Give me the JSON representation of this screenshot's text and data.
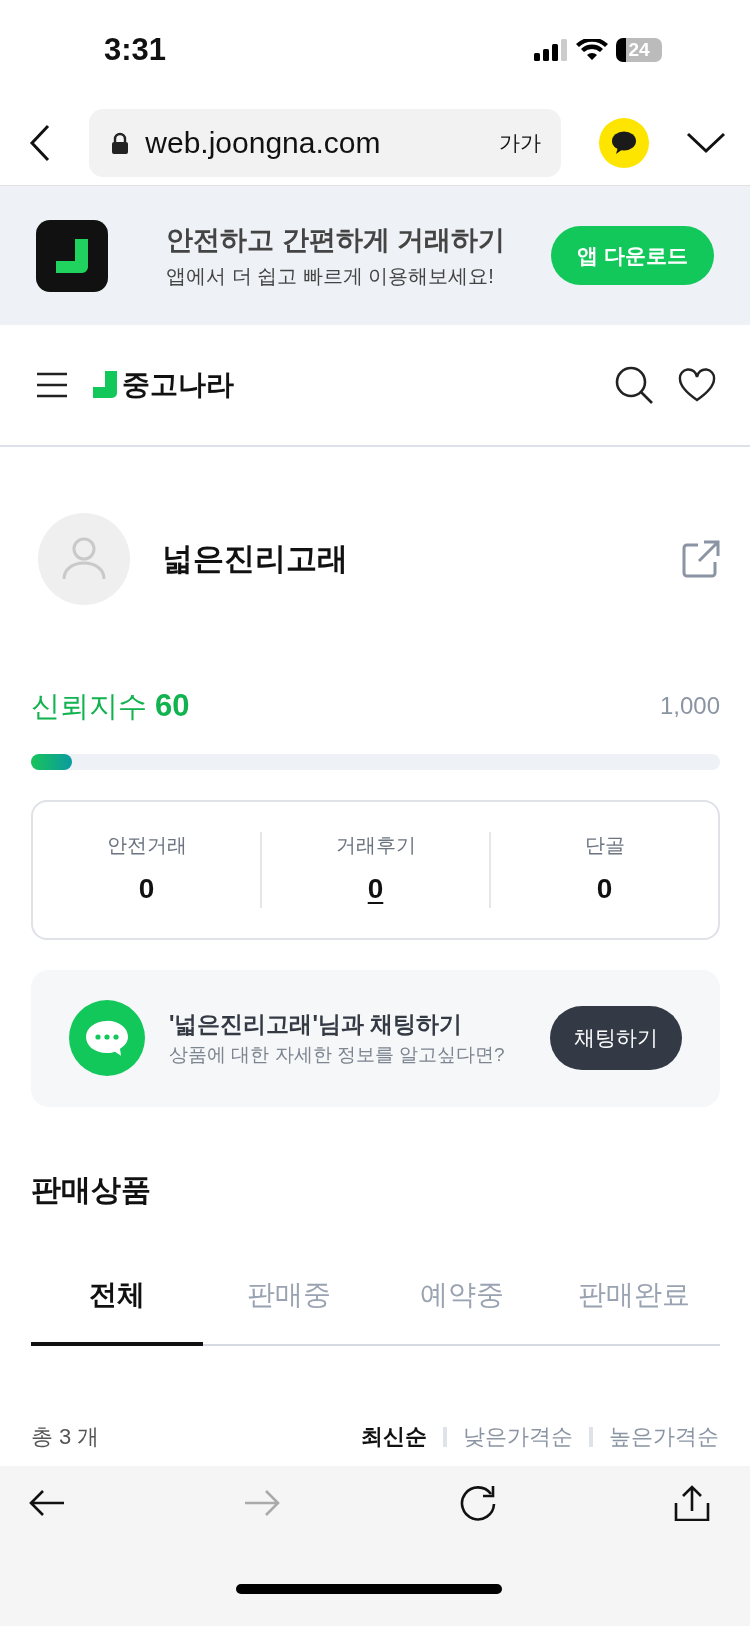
{
  "status_bar": {
    "time": "3:31",
    "battery": "24"
  },
  "browser": {
    "url": "web.joongna.com",
    "text_size_button": "가가"
  },
  "app_banner": {
    "title": "안전하고 간편하게 거래하기",
    "subtitle": "앱에서 더 쉽고 빠르게 이용해보세요!",
    "button": "앱 다운로드"
  },
  "header": {
    "logo": "중고나라"
  },
  "profile": {
    "name": "넓은진리고래"
  },
  "trust": {
    "label": "신뢰지수",
    "score": "60",
    "max": "1,000",
    "level": 0.06
  },
  "stats": [
    {
      "label": "안전거래",
      "value": "0",
      "kind": "text"
    },
    {
      "label": "거래후기",
      "value": "0",
      "kind": "link"
    },
    {
      "label": "단골",
      "value": "0",
      "kind": "text"
    }
  ],
  "chat": {
    "title": "'넓은진리고래'님과 채팅하기",
    "subtitle": "상품에 대한 자세한 정보를 알고싶다면?",
    "button": "채팅하기"
  },
  "section_title": "판매상품",
  "tabs": [
    {
      "label": "전체",
      "selected": true
    },
    {
      "label": "판매중",
      "selected": false
    },
    {
      "label": "예약중",
      "selected": false
    },
    {
      "label": "판매완료",
      "selected": false
    }
  ],
  "total": "총 3 개",
  "sort_options": [
    {
      "label": "최신순",
      "selected": true
    },
    {
      "label": "낮은가격순",
      "selected": false
    },
    {
      "label": "높은가격순",
      "selected": false
    }
  ]
}
